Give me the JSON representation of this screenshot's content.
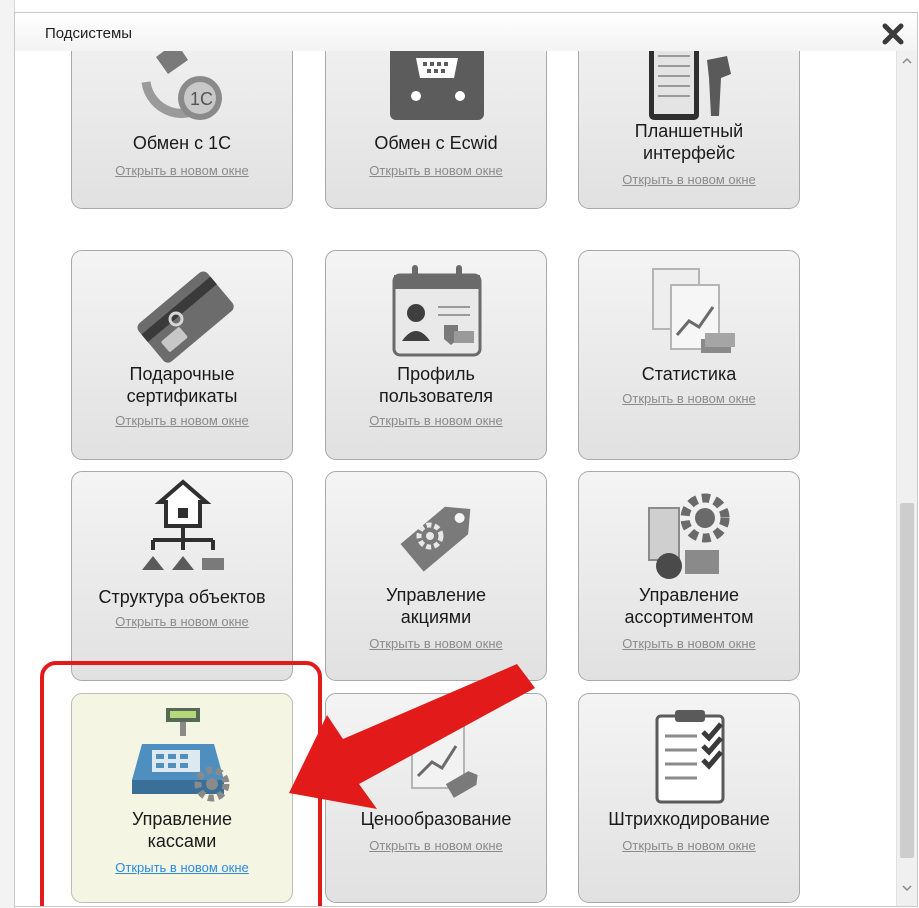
{
  "dialog": {
    "title": "Подсистемы",
    "close_icon": "close-x-icon"
  },
  "subsystems": [
    {
      "label": "Обмен с 1С",
      "link": "Открыть в новом окне",
      "icon": "1c-exchange-icon"
    },
    {
      "label": "Обмен с Ecwid",
      "link": "Открыть в новом окне",
      "icon": "ecwid-cart-icon"
    },
    {
      "label": "Планшетный\nинтерфейс",
      "link": "Открыть в новом окне",
      "icon": "tablet-scanner-icon"
    },
    {
      "label": "Подарочные\nсертификаты",
      "link": "Открыть в новом окне",
      "icon": "gift-card-icon"
    },
    {
      "label": "Профиль\nпользователя",
      "link": "Открыть в новом окне",
      "icon": "user-profile-icon"
    },
    {
      "label": "Статистика",
      "link": "Открыть в новом окне",
      "icon": "statistics-icon"
    },
    {
      "label": "Структура объектов",
      "link": "Открыть в новом окне",
      "icon": "object-structure-icon"
    },
    {
      "label": "Управление\nакциями",
      "link": "Открыть в новом окне",
      "icon": "promo-tag-icon"
    },
    {
      "label": "Управление\nассортиментом",
      "link": "Открыть в новом окне",
      "icon": "assortment-icon"
    },
    {
      "label": "Управление\nкассами",
      "link": "Открыть в новом окне",
      "icon": "cash-register-icon"
    },
    {
      "label": "Ценообразование",
      "link": "Открыть в новом окне",
      "icon": "pricing-icon"
    },
    {
      "label": "Штрихкодирование",
      "link": "Открыть в новом окне",
      "icon": "barcode-checklist-icon"
    }
  ],
  "colors": {
    "highlight": "#e31a1a",
    "link_active": "#2a8be0",
    "active_tile": "#f5f5e3"
  }
}
